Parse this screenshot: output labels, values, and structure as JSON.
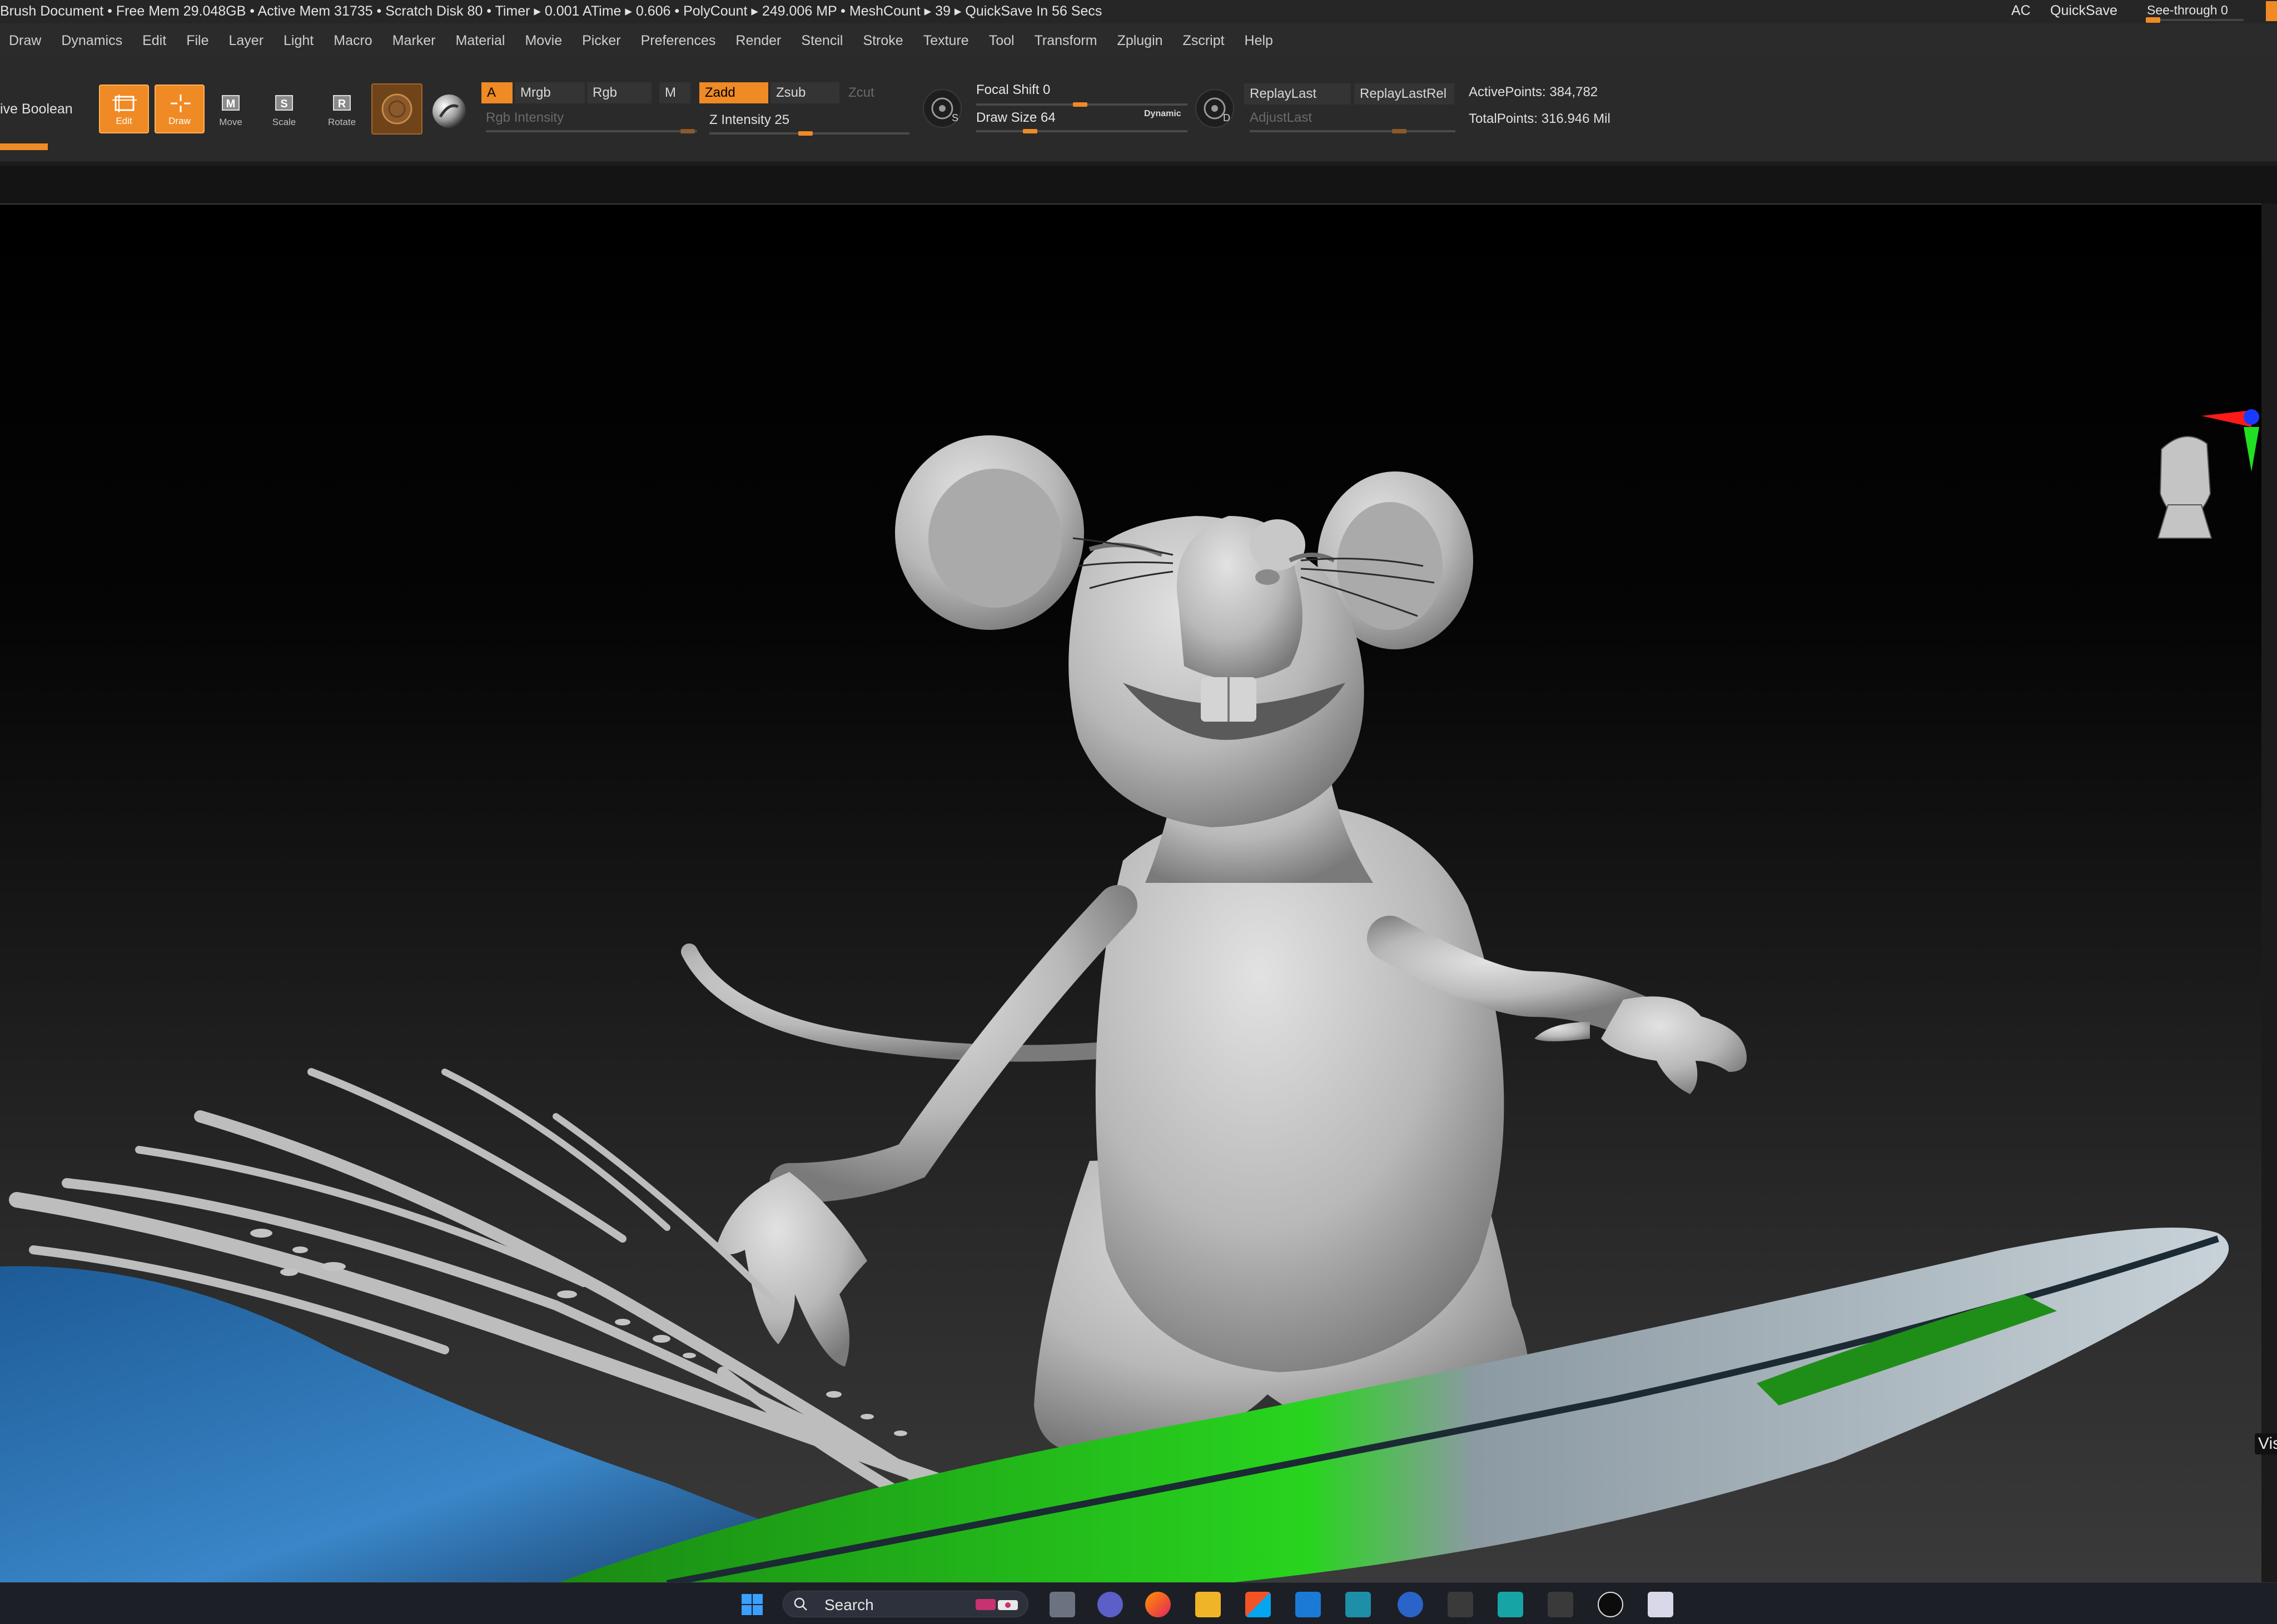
{
  "titlebar": {
    "status": "Brush Document    • Free Mem 29.048GB • Active Mem 31735 • Scratch Disk 80 •  Timer ▸ 0.001 ATime ▸ 0.606 • PolyCount ▸ 249.006 MP  • MeshCount ▸ 39  ▸ QuickSave In 56 Secs",
    "ac_label": "AC",
    "quicksave_label": "QuickSave",
    "seethrough_label": "See-through  0",
    "seethrough_value": 0
  },
  "menu": {
    "items": [
      "Draw",
      "Dynamics",
      "Edit",
      "File",
      "Layer",
      "Light",
      "Macro",
      "Marker",
      "Material",
      "Movie",
      "Picker",
      "Preferences",
      "Render",
      "Stencil",
      "Stroke",
      "Texture",
      "Tool",
      "Transform",
      "Zplugin",
      "Zscript",
      "Help"
    ]
  },
  "shelf": {
    "live_boolean_label": "ive Boolean",
    "tools": [
      {
        "label": "Edit",
        "icon": "edit-icon",
        "active": true
      },
      {
        "label": "Draw",
        "icon": "draw-icon",
        "active": true
      },
      {
        "label": "Move",
        "icon": "move-icon",
        "active": false
      },
      {
        "label": "Scale",
        "icon": "scale-icon",
        "active": false
      },
      {
        "label": "Rotate",
        "icon": "rotate-icon",
        "active": false
      }
    ],
    "a_label": "A",
    "mrgb_label": "Mrgb",
    "rgb_label": "Rgb",
    "m_label": "M",
    "zadd_label": "Zadd",
    "zsub_label": "Zsub",
    "zcut_label": "Zcut",
    "rgb_intensity_label": "Rgb Intensity",
    "z_intensity_label": "Z Intensity 25",
    "z_intensity_value": 25,
    "focal_shift_label": "Focal Shift 0",
    "focal_shift_value": 0,
    "draw_size_label": "Draw Size 64",
    "draw_size_value": 64,
    "dynamic_label": "Dynamic",
    "s_icon_letter": "S",
    "d_icon_letter": "D",
    "replay_last_label": "ReplayLast",
    "replay_last_rel_label": "ReplayLastRel",
    "adjust_last_label": "AdjustLast",
    "active_points_label": "ActivePoints: 384,782",
    "total_points_label": "TotalPoints: 316.946 Mil"
  },
  "canvas": {
    "vis_label": "Vis",
    "colors": {
      "clay": "#bdbdbd",
      "water": "#3a86c8",
      "board_green": "#22c21a",
      "board_grey": "#9aa6ad",
      "accent": "#f08a24"
    }
  },
  "taskbar": {
    "search_placeholder": "Search",
    "icons": [
      "windows-start-icon",
      "task-view-icon",
      "teams-icon",
      "firefox-icon",
      "file-explorer-icon",
      "store-icon",
      "mail-icon",
      "3ds-max-icon",
      "browser-icon",
      "zbrush-icon",
      "maya-icon",
      "zbrush-alt-icon",
      "unreal-icon",
      "snipping-tool-icon"
    ]
  }
}
